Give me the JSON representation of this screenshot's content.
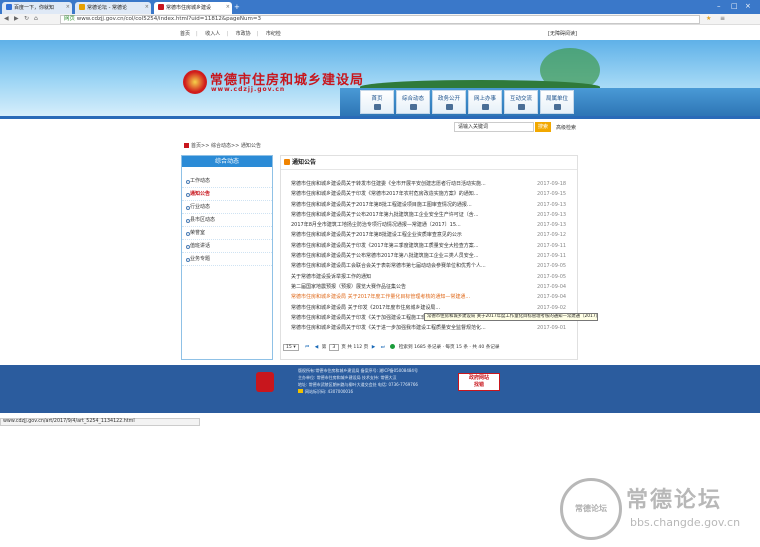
{
  "browser": {
    "tabs": [
      {
        "label": "百度一下，你就知",
        "active": false
      },
      {
        "label": "常德论坛 - 常德论",
        "active": false
      },
      {
        "label": "常德市住房城乡建设",
        "active": true
      }
    ],
    "address_prefix": "网页",
    "url": "www.cdzjj.gov.cn/col/col5254/index.html?uid=11812&pageNum=3",
    "status_url": "www.cdzjj.gov.cn/art/2017/9/4/art_5254_1134122.html"
  },
  "toplinks": [
    "首页",
    "收入人",
    "市政协",
    "市纪检"
  ],
  "topright": "[无障碍阅读]",
  "site": {
    "title": "常德市住房和城乡建设局",
    "url": "www.cdzjj.gov.cn"
  },
  "nav": [
    {
      "label": "首页",
      "icon": "home-icon"
    },
    {
      "label": "综合动态",
      "icon": "news-icon"
    },
    {
      "label": "政务公开",
      "icon": "doc-icon"
    },
    {
      "label": "网上办事",
      "icon": "service-icon"
    },
    {
      "label": "互动交流",
      "icon": "chat-icon"
    },
    {
      "label": "局属单位",
      "icon": "unit-icon"
    }
  ],
  "search": {
    "placeholder": "请输入关键词",
    "button": "搜索",
    "advanced": "高级检索"
  },
  "breadcrumb": "首页>> 综合动态>> 通知公告",
  "sidebar": {
    "title": "综合动态",
    "items": [
      {
        "label": "工作动态",
        "active": false
      },
      {
        "label": "通知公告",
        "active": true
      },
      {
        "label": "行业动态",
        "active": false
      },
      {
        "label": "县市区动态",
        "active": false
      },
      {
        "label": "荣誉室",
        "active": false
      },
      {
        "label": "值班讲话",
        "active": false
      },
      {
        "label": "业务专题",
        "active": false
      }
    ]
  },
  "list_title": "通知公告",
  "notices": [
    {
      "title": "常德市住房和城乡建设局关于转发市住建委《全市开展平安创建志愿者行动日活动实施...",
      "date": "2017-09-18"
    },
    {
      "title": "常德市住房和城乡建设局关于印发《常德市2017年农村危房改造实施方案》的通知...",
      "date": "2017-09-15"
    },
    {
      "title": "常德市住房和城乡建设局关于2017年第8批工程建设项目施工图审查情况的通报...",
      "date": "2017-09-13"
    },
    {
      "title": "常德市住房和城乡建设局关于公布2017年第九批建筑施工企业安全生产许可证（含...",
      "date": "2017-09-13"
    },
    {
      "title": "2017年8月全市建筑工地扬尘防治专项行动情况通报—常建通〔2017〕15...",
      "date": "2017-09-13"
    },
    {
      "title": "常德市住房和城乡建设局关于2017年第8批建设工程企业资质审查意见的公示",
      "date": "2017-09-12"
    },
    {
      "title": "常德市住房和城乡建设局关于印发《2017年第三季度建筑施工质量安全大检查方案...",
      "date": "2017-09-11"
    },
    {
      "title": "常德市住房和城乡建设局关于公布常德市2017年第八批建筑施工企业三类人员安全...",
      "date": "2017-09-11"
    },
    {
      "title": "常德市住房和城乡建设局工会联合会关于表彰常德市第七届动动会参赛单位和优秀个人...",
      "date": "2017-09-05"
    },
    {
      "title": "关于常德市建设投诉举报工作的通知",
      "date": "2017-09-05"
    },
    {
      "title": "第二届国家地震预报（预报）展览大赛作品征集公告",
      "date": "2017-09-04"
    },
    {
      "title": "常德市住房和城乡建设局 关于2017年度工作量化目标管理考核的通知—常建通...",
      "date": "2017-09-04",
      "highlight": true
    },
    {
      "title": "常德市住房和城乡建设局 关于印发《2017年度市住房城乡建设局...",
      "date": "2017-09-02"
    },
    {
      "title": "常德市住房和城乡建设局关于印发《关于加强建设工程施工现场扬尘、噪音试件标准 养...",
      "date": "2017-09-01"
    },
    {
      "title": "常德市住房和城乡建设局关于印发《关于进一步加强我市建设工程质量安全监督规范化...",
      "date": "2017-09-01"
    }
  ],
  "tooltip": "常德市住房和城乡建设局 关于2017年度工作量化目标管理考核的通知—常建通〔2017〕133号",
  "pager": {
    "page_size": "15",
    "first": "⏮",
    "prev": "◀",
    "page_prefix": "第",
    "current": "3",
    "page_suffix": "页",
    "total_pages": "共 112 页",
    "next": "▶",
    "last": "⏭",
    "go": "检索到",
    "total_records": "1685",
    "summary": "条记录 · 每页 15 条 · 共 40 条记录"
  },
  "footer": {
    "lines": [
      "版权所有:常德市住房和城乡建设局 备案序号: 湘ICP备05008484号",
      "主办单位: 常德市住房和城乡建设局 技术支持: 常德大汉",
      "地址: 常德市武陵区朗州路与柳叶大道交会处 电话: 0736-7769766",
      "网站标识码: 4307000016"
    ],
    "badge_line1": "政府网站",
    "badge_line2": "找错"
  },
  "watermark": {
    "circle": "常德论坛",
    "title": "常德论坛",
    "url": "bbs.changde.gov.cn"
  }
}
